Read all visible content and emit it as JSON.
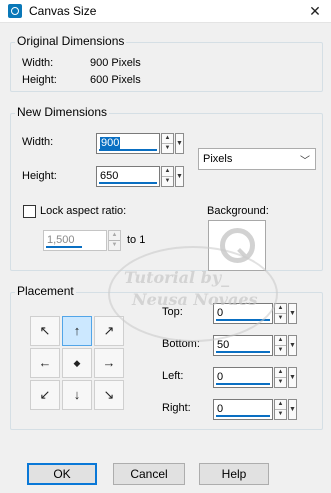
{
  "window": {
    "title": "Canvas Size",
    "close_glyph": "✕"
  },
  "original": {
    "group_label": "Original Dimensions",
    "width_label": "Width:",
    "width_value": "900 Pixels",
    "height_label": "Height:",
    "height_value": "600 Pixels"
  },
  "new_dims": {
    "group_label": "New Dimensions",
    "width_label": "Width:",
    "width_value": "900",
    "height_label": "Height:",
    "height_value": "650",
    "units": "Pixels",
    "lock_label": "Lock aspect ratio:",
    "lock_checked": false,
    "ratio_value": "1,500",
    "ratio_suffix": "to 1",
    "background_label": "Background:"
  },
  "placement": {
    "group_label": "Placement",
    "selected": "top-center",
    "arrows": [
      "↖",
      "↑",
      "↗",
      "←",
      "◆",
      "→",
      "↙",
      "↓",
      "↘"
    ],
    "top_label": "Top:",
    "top_value": "0",
    "bottom_label": "Bottom:",
    "bottom_value": "50",
    "left_label": "Left:",
    "left_value": "0",
    "right_label": "Right:",
    "right_value": "0"
  },
  "buttons": {
    "ok": "OK",
    "cancel": "Cancel",
    "help": "Help"
  },
  "watermark": {
    "line1": "Tutorial by_",
    "line2": "Neusa Novaes"
  },
  "colors": {
    "accent": "#0a6fc2",
    "selected_bg": "#cce8ff"
  }
}
